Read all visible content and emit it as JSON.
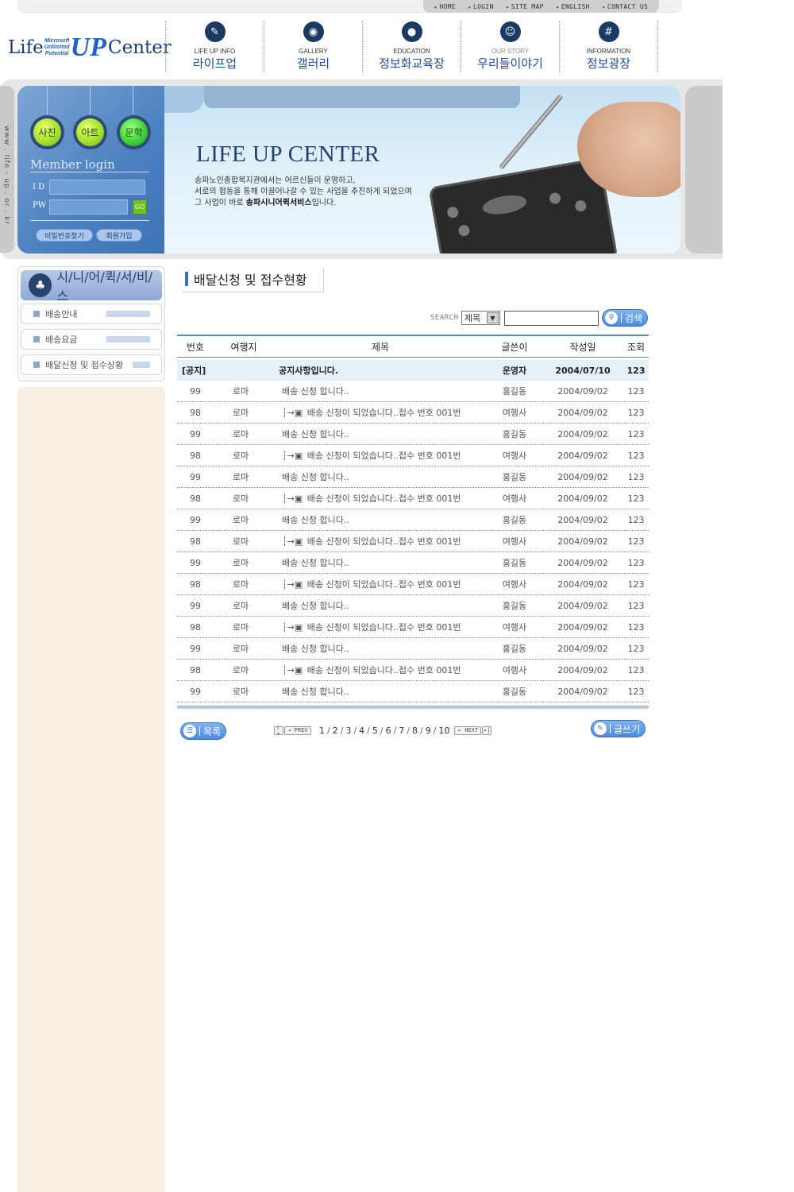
{
  "util_nav": [
    "HOME",
    "LOGIN",
    "SITE MAP",
    "ENGLISH",
    "CONTACT US"
  ],
  "logo": {
    "life": "Life",
    "ms_line1": "Microsoft",
    "ms_line2": "Unlimited",
    "ms_line3": "Potential",
    "up": "UP",
    "center": "Center"
  },
  "main_nav": [
    {
      "en": "LIFE UP INFO",
      "ko": "라이프업",
      "icon": "pen-icon"
    },
    {
      "en": "GALLERY",
      "ko": "갤러리",
      "icon": "eye-icon"
    },
    {
      "en": "EDUCATION",
      "ko": "정보화교육장",
      "icon": "person-icon"
    },
    {
      "en": "OUR STORY",
      "ko": "우리들이야기",
      "icon": "face-icon"
    },
    {
      "en": "INFORMATION",
      "ko": "정보광장",
      "icon": "hash-icon"
    }
  ],
  "side_url": "www . life - up . or . kr",
  "hero": {
    "buttons": [
      "사진",
      "아트",
      "문학"
    ],
    "member_title": "Member login",
    "id_label": "I D",
    "pw_label": "PW",
    "go": "GO",
    "find_pw": "비밀번호찾기",
    "join": "회원가입",
    "title": "LIFE UP CENTER",
    "line1": "송파노인종합복지관에서는 어르신들이 운영하고,",
    "line2": "서로의 협동을 통해 이끌어나갈 수 있는 사업을 추진하게 되었으며",
    "line3_a": "그 사업이 바로 ",
    "line3_b": "송파시니어퀵서비스",
    "line3_c": "입니다."
  },
  "sidebar": {
    "title": "시/니/어/퀵/서/비/스",
    "items": [
      "배송안내",
      "배송요금",
      "배달신청 및 접수상황"
    ]
  },
  "page_title": "배달신청 및 접수현황",
  "search": {
    "label": "SEARCH",
    "select_value": "제목",
    "input_value": "",
    "button": "검색"
  },
  "board": {
    "columns": [
      "번호",
      "여행지",
      "제목",
      "글쓴이",
      "작성일",
      "조회"
    ],
    "notice": {
      "no": "[공지]",
      "dest": "",
      "title": "공지사항입니다.",
      "writer": "운영자",
      "date": "2004/07/10",
      "views": "123"
    },
    "rows": [
      {
        "no": "99",
        "dest": "로마",
        "title": "배송 신청 합니다..",
        "writer": "홍길동",
        "date": "2004/09/02",
        "views": "123",
        "reply": false
      },
      {
        "no": "98",
        "dest": "로마",
        "title": "배송 신청이 되었습니다..접수 번호 001번",
        "writer": "여행사",
        "date": "2004/09/02",
        "views": "123",
        "reply": true
      },
      {
        "no": "99",
        "dest": "로마",
        "title": "배송 신청 합니다..",
        "writer": "홍길동",
        "date": "2004/09/02",
        "views": "123",
        "reply": false
      },
      {
        "no": "98",
        "dest": "로마",
        "title": "배송 신청이 되었습니다..접수 번호 001번",
        "writer": "여행사",
        "date": "2004/09/02",
        "views": "123",
        "reply": true
      },
      {
        "no": "99",
        "dest": "로마",
        "title": "배송 신청 합니다..",
        "writer": "홍길동",
        "date": "2004/09/02",
        "views": "123",
        "reply": false
      },
      {
        "no": "98",
        "dest": "로마",
        "title": "배송 신청이 되었습니다..접수 번호 001번",
        "writer": "여행사",
        "date": "2004/09/02",
        "views": "123",
        "reply": true
      },
      {
        "no": "99",
        "dest": "로마",
        "title": "배송 신청 합니다..",
        "writer": "홍길동",
        "date": "2004/09/02",
        "views": "123",
        "reply": false
      },
      {
        "no": "98",
        "dest": "로마",
        "title": "배송 신청이 되었습니다..접수 번호 001번",
        "writer": "여행사",
        "date": "2004/09/02",
        "views": "123",
        "reply": true
      },
      {
        "no": "99",
        "dest": "로마",
        "title": "배송 신청 합니다..",
        "writer": "홍길동",
        "date": "2004/09/02",
        "views": "123",
        "reply": false
      },
      {
        "no": "98",
        "dest": "로마",
        "title": "배송 신청이 되었습니다..접수 번호 001번",
        "writer": "여행사",
        "date": "2004/09/02",
        "views": "123",
        "reply": true
      },
      {
        "no": "99",
        "dest": "로마",
        "title": "배송 신청 합니다..",
        "writer": "홍길동",
        "date": "2004/09/02",
        "views": "123",
        "reply": false
      },
      {
        "no": "98",
        "dest": "로마",
        "title": "배송 신청이 되었습니다..접수 번호 001번",
        "writer": "여행사",
        "date": "2004/09/02",
        "views": "123",
        "reply": true
      },
      {
        "no": "99",
        "dest": "로마",
        "title": "배송 신청 합니다..",
        "writer": "홍길동",
        "date": "2004/09/02",
        "views": "123",
        "reply": false
      },
      {
        "no": "98",
        "dest": "로마",
        "title": "배송 신청이 되었습니다..접수 번호 001번",
        "writer": "여행사",
        "date": "2004/09/02",
        "views": "123",
        "reply": true
      },
      {
        "no": "99",
        "dest": "로마",
        "title": "배송 신청 합니다..",
        "writer": "홍길동",
        "date": "2004/09/02",
        "views": "123",
        "reply": false
      }
    ]
  },
  "buttons": {
    "list": "목록",
    "write": "글쓰기"
  },
  "pager": {
    "prev": "PREV",
    "next": "NEXT",
    "pages": [
      "1",
      "2",
      "3",
      "4",
      "5",
      "6",
      "7",
      "8",
      "9",
      "10"
    ]
  },
  "colors": {
    "accent": "#3d6fc2",
    "nav_text": "#1f4f9a",
    "notice_bg": "#e6f0f8",
    "sidebar_bg": "#f7eee4"
  }
}
